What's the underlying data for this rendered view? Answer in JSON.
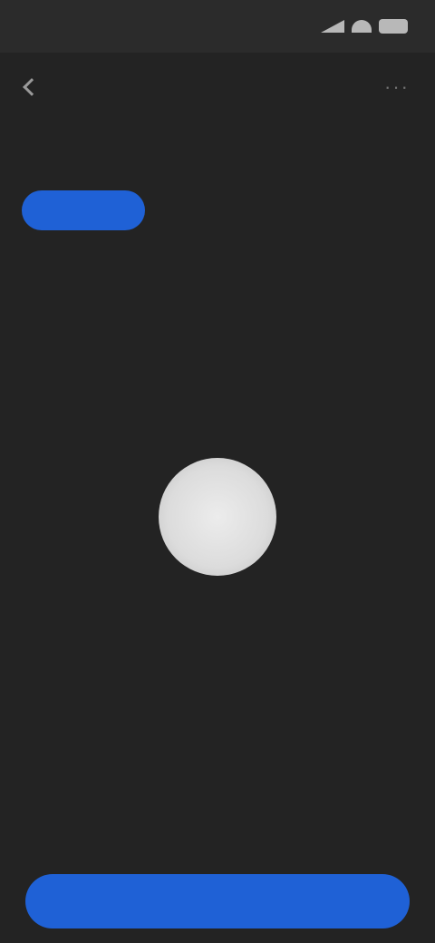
{
  "status_bar": {
    "time": "",
    "icons": [
      "signal-icon",
      "wifi-icon",
      "battery-icon"
    ]
  },
  "nav": {
    "title": "",
    "links": [
      "",
      ""
    ],
    "more_icon": "more-icon"
  },
  "segments": [
    {
      "label": "",
      "value": "",
      "active": true
    },
    {
      "label": "",
      "value": "",
      "active": false
    },
    {
      "label": "",
      "value": "",
      "active": false
    }
  ],
  "empty_state": {
    "title": "",
    "subtitle": ""
  },
  "primary_button": {
    "label": ""
  },
  "colors": {
    "background": "#232323",
    "accent": "#1f61d6"
  }
}
